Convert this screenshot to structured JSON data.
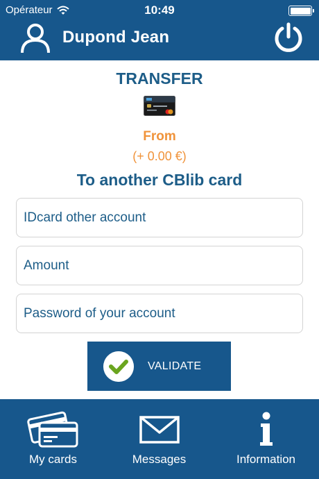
{
  "status_bar": {
    "carrier": "Opérateur",
    "time": "10:49"
  },
  "header": {
    "user_name": "Dupond Jean",
    "user_icon": "user-icon",
    "logout_icon": "power-icon"
  },
  "transfer": {
    "title": "TRANSFER",
    "card_icon": "cblib-card-icon",
    "from_label": "From",
    "balance": "(+ 0.00 €)",
    "subtitle": "To another CBlib card",
    "fields": {
      "idcard_placeholder": "IDcard other account",
      "amount_placeholder": "Amount",
      "password_placeholder": "Password of your account"
    },
    "validate_label": "VALIDATE"
  },
  "tabbar": {
    "items": [
      {
        "label": "My cards",
        "icon": "cards-icon"
      },
      {
        "label": "Messages",
        "icon": "envelope-icon"
      },
      {
        "label": "Information",
        "icon": "info-icon"
      }
    ]
  },
  "colors": {
    "brand_blue": "#17578c",
    "text_blue": "#1d5d88",
    "accent_orange": "#f0933a",
    "check_green": "#6aa51f"
  }
}
